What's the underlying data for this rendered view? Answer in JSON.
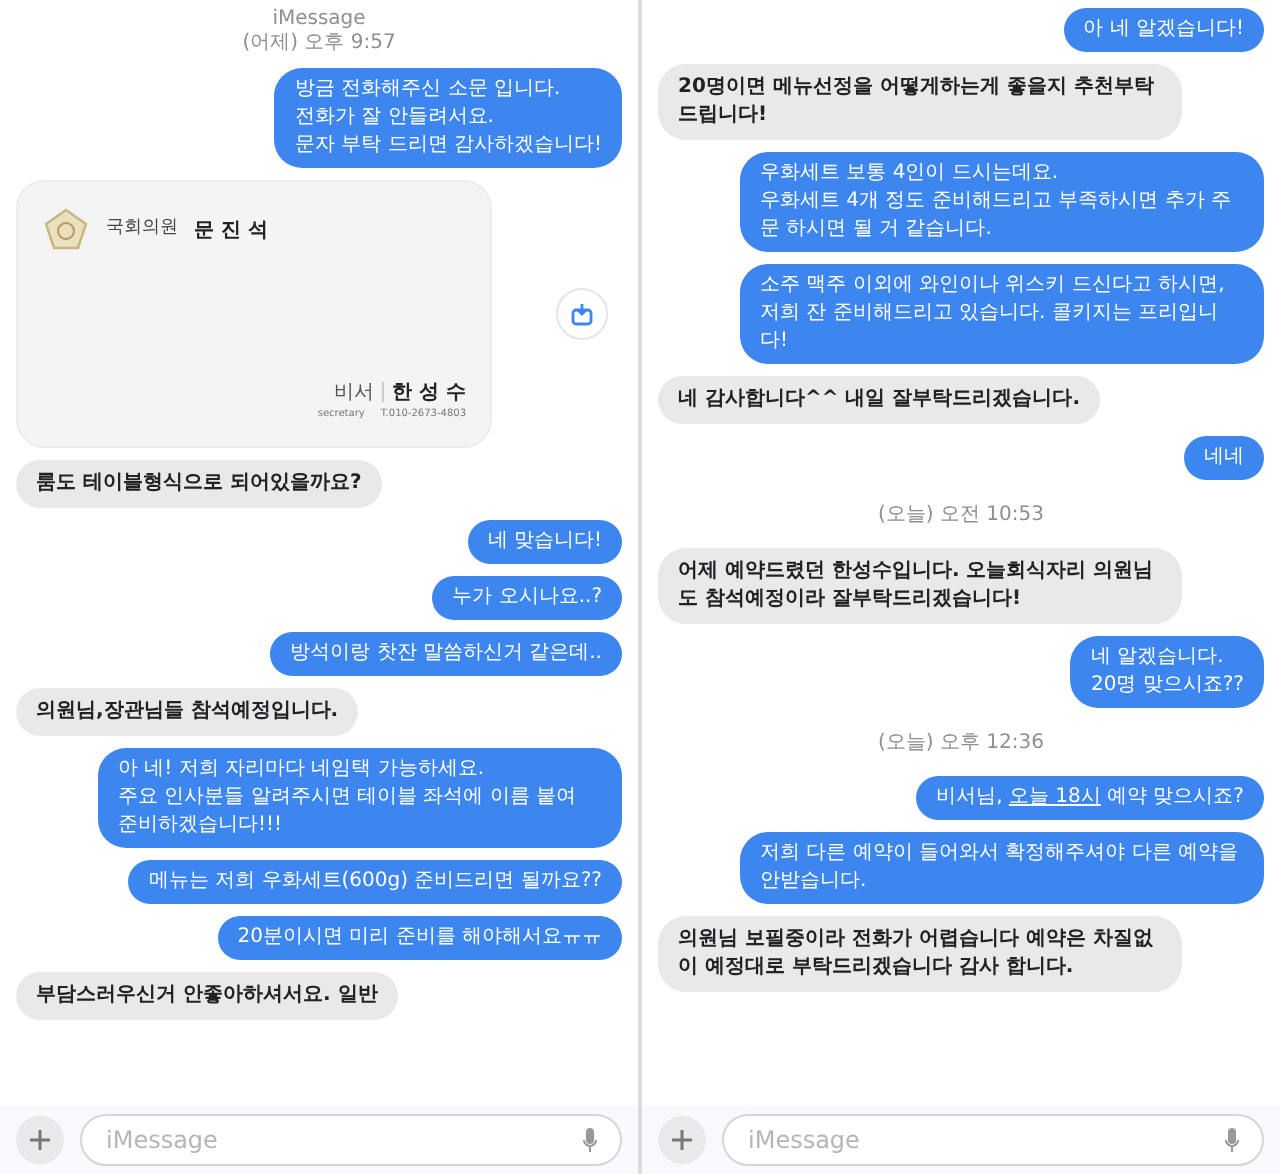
{
  "panels": [
    {
      "items": [
        {
          "kind": "header",
          "service": "iMessage",
          "time": "(어제) 오후 9:57"
        },
        {
          "kind": "sent",
          "text": "방금 전화해주신 소문 입니다.\n전화가 잘 안들려서요.\n문자 부탁 드리면 감사하겠습니다!"
        },
        {
          "kind": "card",
          "title": "국회의원",
          "name": "문 진 석",
          "role": "비서",
          "role_en": "secretary",
          "person": "한 성 수",
          "phone": "T.010-2673-4803"
        },
        {
          "kind": "received",
          "text": "룸도 테이블형식으로 되어있을까요?"
        },
        {
          "kind": "sent",
          "text": "네 맞습니다!"
        },
        {
          "kind": "sent",
          "text": "누가 오시나요..?"
        },
        {
          "kind": "sent",
          "text": "방석이랑 찻잔 말씀하신거 같은데.."
        },
        {
          "kind": "received",
          "text": "의원님,장관님들 참석예정입니다."
        },
        {
          "kind": "sent",
          "text": "아 네! 저희 자리마다 네임택 가능하세요.\n주요 인사분들 알려주시면 테이블 좌석에 이름 붙여 준비하겠습니다!!!"
        },
        {
          "kind": "sent",
          "text": "메뉴는 저희 우화세트(600g) 준비드리면 될까요??"
        },
        {
          "kind": "sent",
          "text": "20분이시면 미리 준비를 해야해서요ㅠㅠ"
        },
        {
          "kind": "received",
          "text": "부담스러우신거 안좋아하셔서요. 일반"
        }
      ],
      "input": {
        "placeholder": "iMessage"
      }
    },
    {
      "items": [
        {
          "kind": "sent",
          "text": "아 네 알겠습니다!"
        },
        {
          "kind": "received",
          "text": "20명이면 메뉴선정을 어떻게하는게 좋을지 추천부탁드립니다!"
        },
        {
          "kind": "sent",
          "text": "우화세트 보통 4인이 드시는데요.\n우화세트 4개 정도 준비해드리고 부족하시면 추가 주문 하시면 될 거 같습니다."
        },
        {
          "kind": "sent",
          "text": "소주 맥주 이외에 와인이나 위스키 드신다고 하시면, 저희 잔 준비해드리고 있습니다. 콜키지는 프리입니다!"
        },
        {
          "kind": "received",
          "text": "네 감사합니다^^ 내일 잘부탁드리겠습니다."
        },
        {
          "kind": "sent",
          "text": "네네"
        },
        {
          "kind": "time",
          "time": "(오늘) 오전 10:53"
        },
        {
          "kind": "received",
          "text": "어제 예약드렸던 한성수입니다. 오늘회식자리 의원님도 참석예정이라 잘부탁드리겠습니다!"
        },
        {
          "kind": "sent",
          "text": "네 알겠습니다.\n20명 맞으시죠??"
        },
        {
          "kind": "time",
          "time": "(오늘) 오후 12:36"
        },
        {
          "kind": "sent_link",
          "before": "비서님, ",
          "link": "오늘 18시",
          "after": " 예약 맞으시죠?"
        },
        {
          "kind": "sent",
          "text": "저희 다른 예약이 들어와서 확정해주셔야 다른 예약을 안받습니다."
        },
        {
          "kind": "received",
          "text": "의원님 보필중이라 전화가 어렵습니다 예약은 차질없이 예정대로 부탁드리겠습니다 감사 합니다."
        }
      ],
      "input": {
        "placeholder": "iMessage"
      }
    }
  ]
}
